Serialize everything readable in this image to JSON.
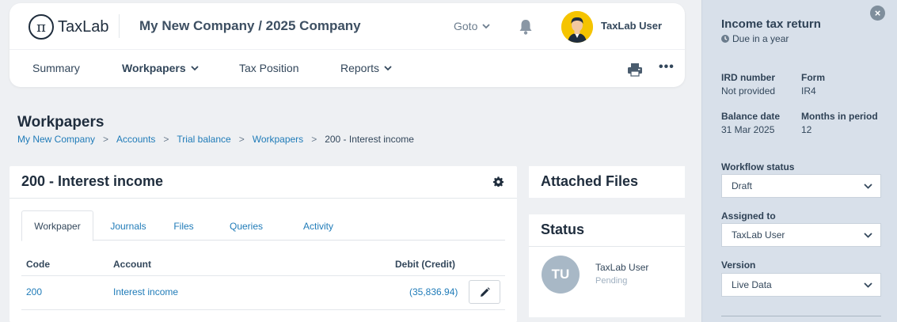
{
  "app": {
    "logo_symbol": "π",
    "logo_text": "TaxLab",
    "company_title": "My New Company / 2025 Company",
    "goto_label": "Goto",
    "user_name": "TaxLab User"
  },
  "nav": {
    "items": [
      {
        "label": "Summary",
        "active": false,
        "dropdown": false
      },
      {
        "label": "Workpapers",
        "active": true,
        "dropdown": true
      },
      {
        "label": "Tax Position",
        "active": false,
        "dropdown": false
      },
      {
        "label": "Reports",
        "active": false,
        "dropdown": true
      }
    ],
    "more_label": "•••"
  },
  "page": {
    "title": "Workpapers",
    "breadcrumb": [
      {
        "label": "My New Company",
        "link": true
      },
      {
        "label": "Accounts",
        "link": true
      },
      {
        "label": "Trial balance",
        "link": true
      },
      {
        "label": "Workpapers",
        "link": true
      },
      {
        "label": "200 - Interest income",
        "link": false
      }
    ],
    "breadcrumb_sep": ">"
  },
  "workpaper": {
    "title": "200 - Interest income",
    "tabs": [
      "Workpaper",
      "Journals",
      "Files",
      "Queries",
      "Activity"
    ],
    "active_tab": "Workpaper",
    "columns": {
      "code": "Code",
      "account": "Account",
      "amount": "Debit (Credit)"
    },
    "rows": [
      {
        "code": "200",
        "account": "Interest income",
        "amount": "(35,836.94)"
      }
    ]
  },
  "attached_files": {
    "title": "Attached Files"
  },
  "status": {
    "title": "Status",
    "initials": "TU",
    "user": "TaxLab User",
    "state": "Pending"
  },
  "drawer": {
    "close_symbol": "×",
    "title": "Income tax return",
    "due": "Due in a year",
    "ird_label": "IRD number",
    "ird_value": "Not provided",
    "form_label": "Form",
    "form_value": "IR4",
    "balance_date_label": "Balance date",
    "balance_date_value": "31 Mar 2025",
    "months_label": "Months in period",
    "months_value": "12",
    "workflow_label": "Workflow status",
    "workflow_value": "Draft",
    "assigned_label": "Assigned to",
    "assigned_value": "TaxLab User",
    "version_label": "Version",
    "version_value": "Live Data"
  },
  "colors": {
    "link": "#1f7bb8",
    "heading": "#1f2d3d",
    "drawer_bg": "#d8e0ea",
    "avatar_bg": "#f5c400",
    "status_avatar_bg": "#a8b8c6"
  }
}
